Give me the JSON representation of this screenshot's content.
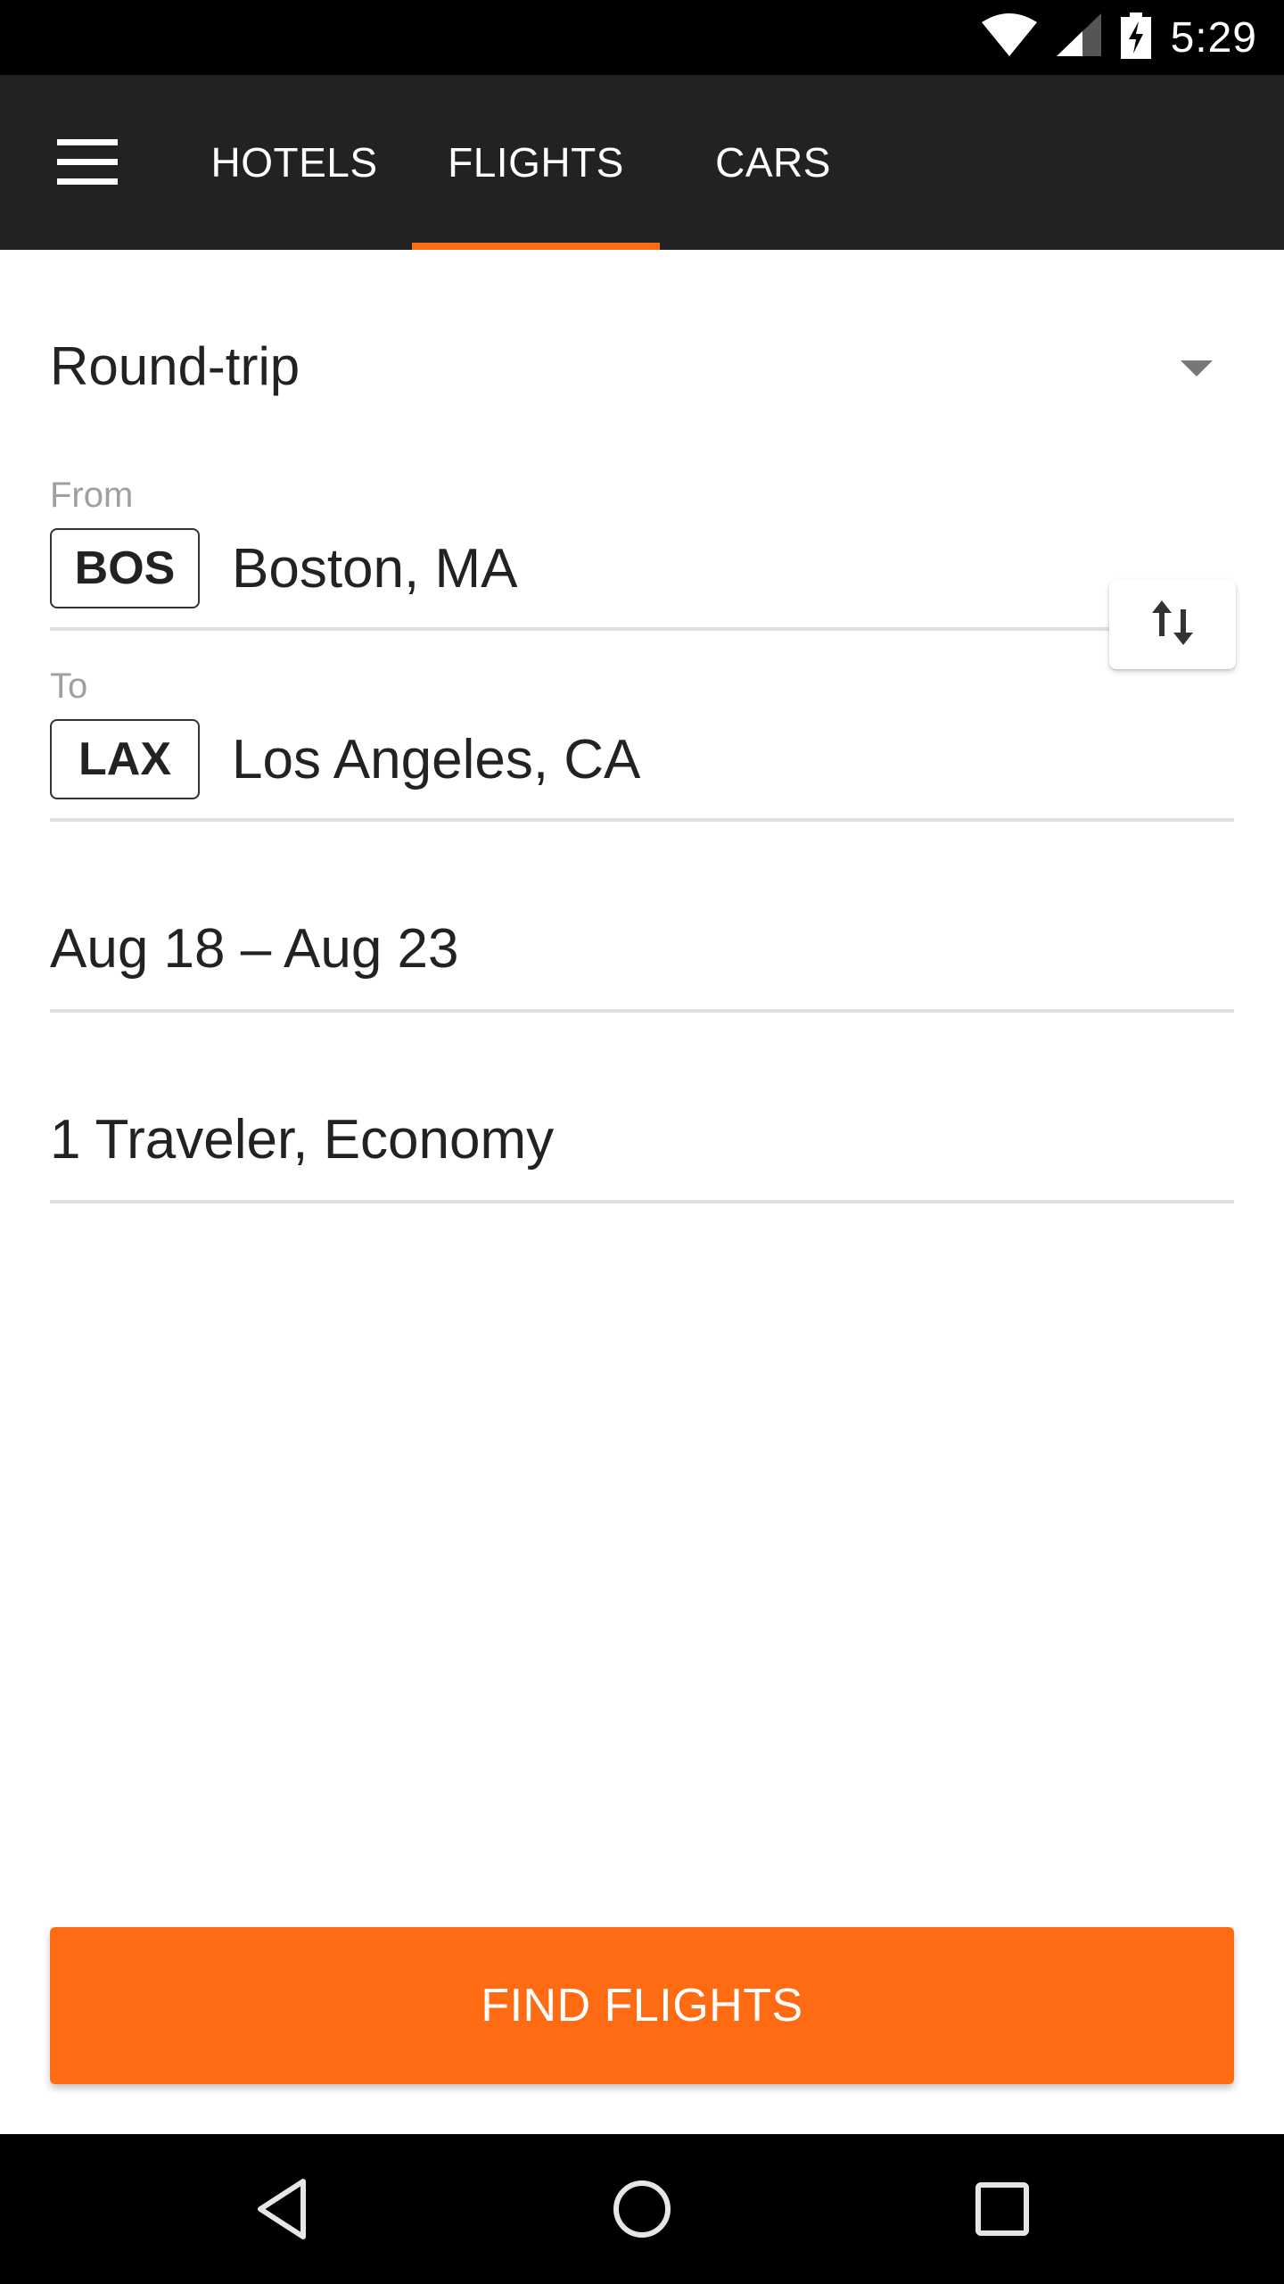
{
  "status_bar": {
    "time": "5:29",
    "icons": [
      "wifi-icon",
      "cell-signal-icon",
      "battery-charging-icon"
    ]
  },
  "app_bar": {
    "menu_icon": "hamburger-menu-icon",
    "tabs": [
      {
        "label": "HOTELS",
        "selected": false
      },
      {
        "label": "FLIGHTS",
        "selected": true
      },
      {
        "label": "CARS",
        "selected": false
      }
    ]
  },
  "form": {
    "trip_type": {
      "selected": "Round-trip",
      "icon": "dropdown-arrow-icon"
    },
    "from": {
      "label": "From",
      "code": "BOS",
      "city": "Boston, MA"
    },
    "to": {
      "label": "To",
      "code": "LAX",
      "city": "Los Angeles, CA"
    },
    "swap_icon": "swap-vertical-icon",
    "dates": "Aug 18 – Aug 23",
    "travelers": "1 Traveler, Economy"
  },
  "cta": {
    "label": "FIND FLIGHTS"
  },
  "nav_bar": {
    "icons": [
      "back-icon",
      "home-icon",
      "recents-icon"
    ]
  },
  "colors": {
    "accent": "#ff6b12",
    "app_bar": "#222222",
    "status_bar": "#000000",
    "text_primary": "#222222",
    "label": "#a0a0a0",
    "divider": "#e0e0e4"
  }
}
